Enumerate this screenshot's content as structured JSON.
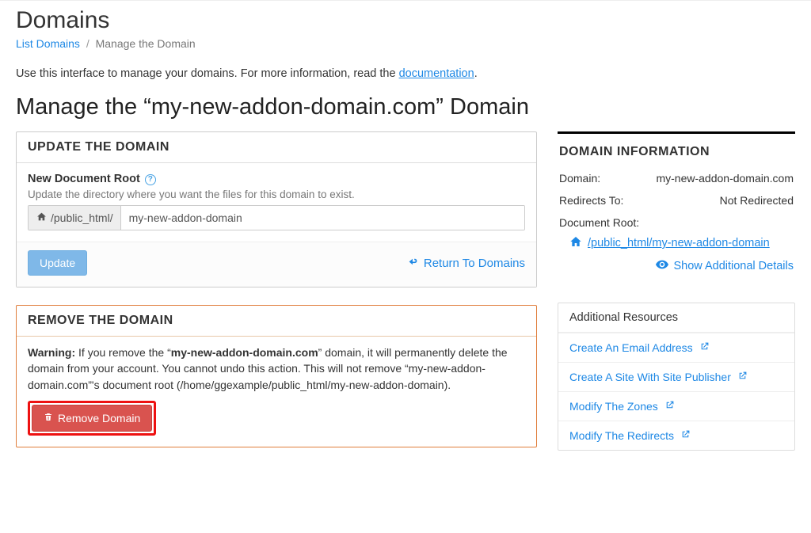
{
  "page_title": "Domains",
  "breadcrumb": {
    "list_link": "List Domains",
    "current": "Manage the Domain"
  },
  "intro": {
    "text_pre": "Use this interface to manage your domains. For more information, read the ",
    "doc_link": "documentation",
    "text_post": "."
  },
  "section_heading": "Manage the “my-new-addon-domain.com” Domain",
  "update_panel": {
    "title": "UPDATE THE DOMAIN",
    "field_label": "New Document Root",
    "field_desc": "Update the directory where you want the files for this domain to exist.",
    "addon_prefix": "/public_html/",
    "input_value": "my-new-addon-domain",
    "update_btn": "Update",
    "return_link": "Return To Domains"
  },
  "remove_panel": {
    "title": "REMOVE THE DOMAIN",
    "warn_label": "Warning:",
    "warn_pre": " If you remove the “",
    "domain": "my-new-addon-domain.com",
    "warn_post": "” domain, it will permanently delete the domain from your account. You cannot undo this action. This will not remove “my-new-addon-domain.com”'s document root (/home/ggexample/public_html/my-new-addon-domain).",
    "remove_btn": "Remove Domain"
  },
  "domain_info": {
    "title": "DOMAIN INFORMATION",
    "rows": [
      {
        "lab": "Domain:",
        "val": "my-new-addon-domain.com"
      },
      {
        "lab": "Redirects To:",
        "val": "Not Redirected"
      }
    ],
    "docroot_label": "Document Root:",
    "docroot_path": "/public_html/my-new-addon-domain",
    "show_more": "Show Additional Details"
  },
  "resources": {
    "title": "Additional Resources",
    "items": [
      "Create An Email Address",
      "Create A Site With Site Publisher",
      "Modify The Zones",
      "Modify The Redirects"
    ]
  }
}
